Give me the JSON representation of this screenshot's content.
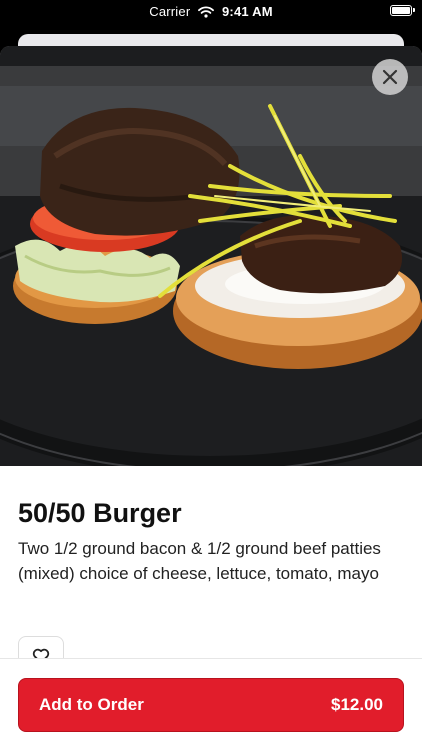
{
  "status_bar": {
    "carrier": "Carrier",
    "time": "9:41 AM"
  },
  "item": {
    "name": "50/50 Burger",
    "description": "Two 1/2 ground bacon & 1/2 ground beef patties (mixed) choice of cheese, lettuce, tomato, mayo"
  },
  "cta": {
    "label": "Add to Order",
    "price": "$12.00"
  },
  "colors": {
    "accent": "#e11d2b"
  },
  "icons": [
    "wifi-icon",
    "battery-icon",
    "close-icon",
    "heart-icon"
  ]
}
